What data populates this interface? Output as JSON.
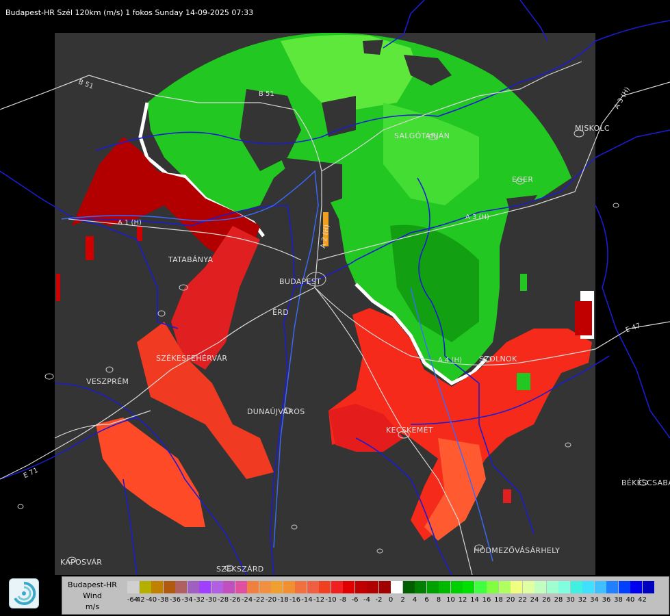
{
  "header": {
    "title": "Budapest-HR Szél 120km (m/s) 1 fokos Sunday 14-09-2025 07:33"
  },
  "cities": [
    {
      "id": "tatabanya",
      "name": "TATABÁNYA"
    },
    {
      "id": "budapest",
      "name": "BUDAPEST"
    },
    {
      "id": "erd",
      "name": "ÉRD"
    },
    {
      "id": "szekesfehervar",
      "name": "SZÉKESFEHÉRVÁR"
    },
    {
      "id": "veszprem",
      "name": "VESZPRÉM"
    },
    {
      "id": "dunaujvaros",
      "name": "DUNAÚJVÁROS"
    },
    {
      "id": "kecskemet",
      "name": "KECSKEMÉT"
    },
    {
      "id": "hodmezovasarhely",
      "name": "HÓDMEZŐVÁSÁRHELY"
    },
    {
      "id": "kaposvar",
      "name": "KAPOSVÁR"
    },
    {
      "id": "szekszard",
      "name": "SZEKSZÁRD"
    },
    {
      "id": "bekescsaba",
      "name": "BÉKÉSCSABA"
    },
    {
      "id": "miskolc",
      "name": "MISKOLC"
    },
    {
      "id": "salgotarjan",
      "name": "SALGÓTARJÁN"
    },
    {
      "id": "eger",
      "name": "EGER"
    },
    {
      "id": "szolnok",
      "name": "SZOLNOK"
    }
  ],
  "roads": [
    {
      "id": "b51-west",
      "name": "B 51"
    },
    {
      "id": "b51-north",
      "name": "B 51"
    },
    {
      "id": "a1",
      "name": "A 1 (H)"
    },
    {
      "id": "a2",
      "name": "A 2 (H)"
    },
    {
      "id": "a3-east",
      "name": "A 3 (H)"
    },
    {
      "id": "a3-north",
      "name": "A 3 (H)"
    },
    {
      "id": "a4",
      "name": "A 4 (H)"
    },
    {
      "id": "e71",
      "name": "E 71"
    },
    {
      "id": "e47",
      "name": "E 47"
    }
  ],
  "legend": {
    "title_line1": "Budapest-HR",
    "title_line2": "Wind",
    "title_line3": "m/s",
    "ticks": [
      "-64",
      "-42",
      "-40",
      "-38",
      "-36",
      "-34",
      "-32",
      "-30",
      "-28",
      "-26",
      "-24",
      "-22",
      "-20",
      "-18",
      "-16",
      "-14",
      "-12",
      "-10",
      "-8",
      "-6",
      "-4",
      "-2",
      "0",
      "2",
      "4",
      "6",
      "8",
      "10",
      "12",
      "14",
      "16",
      "18",
      "20",
      "22",
      "24",
      "26",
      "28",
      "30",
      "32",
      "34",
      "36",
      "38",
      "40",
      "42"
    ],
    "colors": [
      "#d0d0d0",
      "#b5b000",
      "#c08000",
      "#b05a10",
      "#b06060",
      "#a060c0",
      "#a040ff",
      "#b060e0",
      "#c050c0",
      "#e050a0",
      "#f08040",
      "#f09040",
      "#f0a030",
      "#f09030",
      "#f07040",
      "#f06040",
      "#f04020",
      "#f02020",
      "#e00000",
      "#c00000",
      "#b00000",
      "#a00000",
      "#ffffff",
      "#006000",
      "#008000",
      "#00a000",
      "#00b800",
      "#00d000",
      "#00e000",
      "#40ff40",
      "#80ff40",
      "#b0ff60",
      "#f0ff80",
      "#e0ffa0",
      "#c0ffc0",
      "#a0ffd0",
      "#80ffe0",
      "#40f0e0",
      "#40e0ff",
      "#40c0ff",
      "#2080ff",
      "#0040ff",
      "#0000f0",
      "#0000c0"
    ]
  }
}
